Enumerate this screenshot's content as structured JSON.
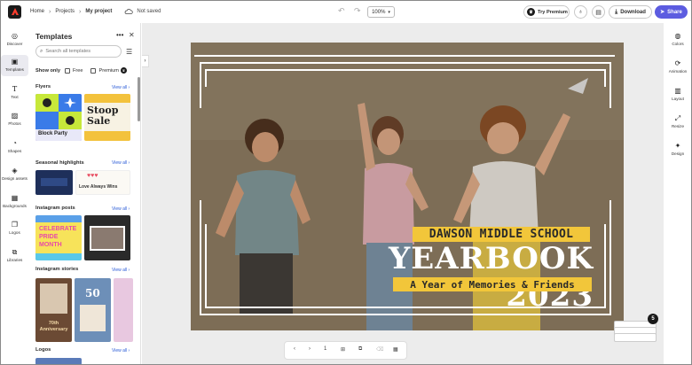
{
  "topbar": {
    "breadcrumb": [
      "Home",
      "Projects",
      "My project"
    ],
    "save_status": "Not saved",
    "zoom": "100%",
    "try_premium": "Try Premium",
    "download": "Download",
    "share": "Share"
  },
  "left_rail": [
    {
      "label": "Discover",
      "icon": "compass-icon"
    },
    {
      "label": "Templates",
      "icon": "templates-icon"
    },
    {
      "label": "Text",
      "icon": "text-icon"
    },
    {
      "label": "Photos",
      "icon": "photo-icon"
    },
    {
      "label": "Shapes",
      "icon": "shapes-icon"
    },
    {
      "label": "Design assets",
      "icon": "assets-icon"
    },
    {
      "label": "Backgrounds",
      "icon": "background-icon"
    },
    {
      "label": "Logos",
      "icon": "logo-icon"
    },
    {
      "label": "Libraries",
      "icon": "libraries-icon"
    }
  ],
  "panel": {
    "title": "Templates",
    "search_placeholder": "Search all templates",
    "show_only": "Show only",
    "filter_free": "Free",
    "filter_premium": "Premium",
    "view_all": "View all",
    "sections": [
      {
        "title": "Flyers"
      },
      {
        "title": "Seasonal highlights"
      },
      {
        "title": "Instagram posts"
      },
      {
        "title": "Instagram stories"
      },
      {
        "title": "Logos"
      }
    ],
    "thumb_texts": {
      "block_party": "Block Party",
      "stoop_sale": "Stoop Sale",
      "love_always": "Love Always Wins",
      "celebrate": "CELEBRATE PRIDE MONTH",
      "fifty": "50",
      "anniversary": "70th Anniversary"
    }
  },
  "canvas": {
    "line1": "DAWSON MIDDLE SCHOOL",
    "line2": "YEARBOOK 2023",
    "line3": "A Year of Memories & Friends",
    "accent": "#f2c63a",
    "background": "#8b7a60"
  },
  "pager": {
    "page": "1"
  },
  "pages_count": "5",
  "right_rail": [
    {
      "label": "Colors",
      "icon": "palette-icon"
    },
    {
      "label": "Animation",
      "icon": "animation-icon"
    },
    {
      "label": "Layout",
      "icon": "layout-icon"
    },
    {
      "label": "Resize",
      "icon": "resize-icon"
    },
    {
      "label": "Design",
      "icon": "design-icon"
    }
  ]
}
